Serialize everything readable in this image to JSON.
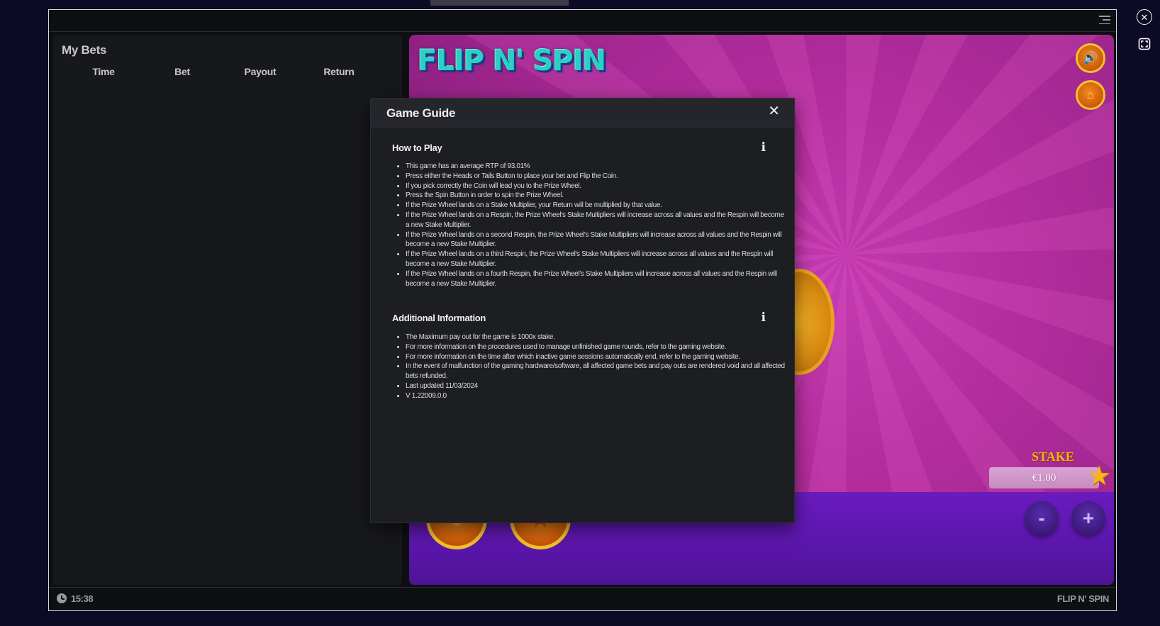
{
  "frame": {
    "menu_icon": "hamburger-icon"
  },
  "window_controls": {
    "close_icon": "close-circle-icon",
    "fullscreen_icon": "fullscreen-icon"
  },
  "bets_panel": {
    "title": "My Bets",
    "columns": [
      "Time",
      "Bet",
      "Payout",
      "Return"
    ]
  },
  "game": {
    "logo_text": "FLIP N' SPIN",
    "sound_icon": "speaker-icon",
    "home_icon": "home-icon",
    "stake_label": "STAKE",
    "stake_value": "€1.00",
    "minus_label": "-",
    "plus_label": "+"
  },
  "footer": {
    "clock_icon": "clock-icon",
    "time": "15:38",
    "brand": "FLIP N' SPIN"
  },
  "modal": {
    "title": "Game Guide",
    "close_glyph": "✕",
    "how_to_play": {
      "title": "How to Play",
      "info_glyph": "i",
      "items": [
        "This game has an average RTP of 93.01%",
        "Press either the Heads or Tails Button to place your bet and Flip the Coin.",
        "If you pick correctly the Coin will lead you to the Prize Wheel.",
        "Press the Spin Button in order to spin the Prize Wheel.",
        "If the Prize Wheel lands on a Stake Multiplier, your Return will be multiplied by that value.",
        "If the Prize Wheel lands on a Respin, the Prize Wheel's Stake Multipliers will increase across all values and the Respin will become a new Stake Multiplier.",
        "If the Prize Wheel lands on a second Respin, the Prize Wheel's Stake Multipliers will increase across all values and the Respin will become a new Stake Multiplier.",
        "If the Prize Wheel lands on a third Respin, the Prize Wheel's Stake Multipliers will increase across all values and the Respin will become a new Stake Multiplier.",
        "If the Prize Wheel lands on a fourth Respin, the Prize Wheel's Stake Multipliers will increase across all values and the Respin will become a new Stake Multiplier."
      ]
    },
    "additional_info": {
      "title": "Additional Information",
      "info_glyph": "i",
      "items": [
        "The Maximum pay out for the game is 1000x stake.",
        "For more information on the procedures used to manage unfinished game rounds, refer to the gaming website.",
        "For more information on the time after which inactive game sessions automatically end, refer to the gaming website.",
        "In the event of malfunction of the gaming hardware/software, all affected game bets and pay outs are rendered void and all affected bets refunded.",
        "Last updated 11/03/2024",
        "V 1.22009.0.0"
      ]
    }
  }
}
